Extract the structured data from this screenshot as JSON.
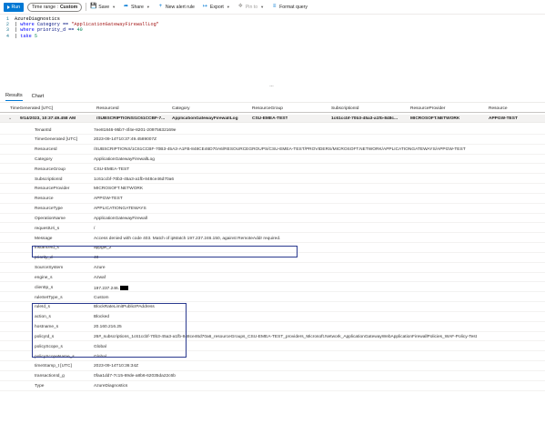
{
  "toolbar": {
    "run_label": "Run",
    "time_range_label": "Time range :",
    "time_range_value": "Custom",
    "save_label": "Save",
    "share_label": "Share",
    "new_alert_label": "New alert rule",
    "export_label": "Export",
    "pin_label": "Pin to",
    "format_label": "Format query"
  },
  "editor": {
    "lines": [
      {
        "num": "1",
        "parts": [
          {
            "t": "AzureDiagnostics",
            "c": "plain"
          }
        ]
      },
      {
        "num": "2",
        "parts": [
          {
            "t": "| ",
            "c": "plain"
          },
          {
            "t": "where",
            "c": "kw"
          },
          {
            "t": " Category == ",
            "c": "id"
          },
          {
            "t": "\"ApplicationGatewayFirewallLog\"",
            "c": "str"
          }
        ]
      },
      {
        "num": "3",
        "parts": [
          {
            "t": "| ",
            "c": "plain"
          },
          {
            "t": "where",
            "c": "kw"
          },
          {
            "t": " priority_d == ",
            "c": "id"
          },
          {
            "t": "40",
            "c": "num"
          }
        ]
      },
      {
        "num": "4",
        "parts": [
          {
            "t": "| ",
            "c": "plain"
          },
          {
            "t": "take",
            "c": "kw"
          },
          {
            "t": " ",
            "c": "plain"
          },
          {
            "t": "5",
            "c": "num"
          }
        ]
      }
    ]
  },
  "results_tabs": [
    "Results",
    "Chart"
  ],
  "grid": {
    "columns": [
      "TimeGenerated [UTC]",
      "ResourceId",
      "Category",
      "ResourceGroup",
      "SubscriptionId",
      "ResourceProvider",
      "Resource"
    ],
    "row": [
      "9/14/2023, 10:37:49.458 AM",
      "/SUBSCRIPTIONS/1C61CCBF-7...",
      "ApplicationGatewayFirewallLog",
      "CSU-EMEA-TEST",
      "1c61ccbf-70b3-45a3-a1fb-848c...",
      "MICROSOFT.NETWORK",
      "APPGW-TEST"
    ]
  },
  "details": [
    {
      "key": "TenantId",
      "value": "7ee81846-95b7-4f4e-8201-20975632169e"
    },
    {
      "key": "TimeGenerated [UTC]",
      "value": "2023-09-14T10:37:49.4589007Z"
    },
    {
      "key": "ResourceId",
      "value": "/SUBSCRIPTIONS/1C61CCBF-70B3-45A3-A1FB-848CE46D70A6/RESOURCEGROUPS/CSU-EMEA-TEST/PROVIDERS/MICROSOFT.NETWORK/APPLICATIONGATEWAYS/APPGW-TEST"
    },
    {
      "key": "Category",
      "value": "ApplicationGatewayFirewallLog"
    },
    {
      "key": "ResourceGroup",
      "value": "CSU-EMEA-TEST"
    },
    {
      "key": "SubscriptionId",
      "value": "1c61ccbf-70b3-45a3-a1fb-848ce46d70a6"
    },
    {
      "key": "ResourceProvider",
      "value": "MICROSOFT.NETWORK"
    },
    {
      "key": "Resource",
      "value": "APPGW-TEST"
    },
    {
      "key": "ResourceType",
      "value": "APPLICATIONGATEWAYS"
    },
    {
      "key": "OperationName",
      "value": "ApplicationGatewayFirewall"
    },
    {
      "key": "requestUri_s",
      "value": "/"
    },
    {
      "key": "Message",
      "value": "Access denied with code 403. Match of ipMatch 197.237.246.150, against RemoteAddr required."
    },
    {
      "key": "instanceId_s",
      "value": "appgw_2"
    },
    {
      "key": "priority_d",
      "value": "40"
    },
    {
      "key": "SourceSystem",
      "value": "Azure"
    },
    {
      "key": "engine_s",
      "value": "Azwaf"
    },
    {
      "key": "clientIp_s",
      "value": "197.237.246.",
      "redacted": true
    },
    {
      "key": "ruleSetType_s",
      "value": "Custom"
    },
    {
      "key": "ruleId_s",
      "value": "BlockRateLimitPublicIPAddress"
    },
    {
      "key": "action_s",
      "value": "Blocked"
    },
    {
      "key": "hostname_s",
      "value": "20.160.216.25"
    },
    {
      "key": "policyId_s",
      "value": "26#_subscriptions_1c61ccbf-70b3-45a3-a1fb-848ce46d70a6_resourceGroups_CSU-EMEA-TEST_providers_Microsoft.Network_ApplicationGatewayWebApplicationFirewallPolicies_WAF-Policy-Test"
    },
    {
      "key": "policyScope_s",
      "value": "Global"
    },
    {
      "key": "policyScopeName_s",
      "value": "Global"
    },
    {
      "key": "timeStamp_t [UTC]",
      "value": "2023-09-14T10:36:34Z"
    },
    {
      "key": "transactionId_g",
      "value": "0faa1dd7-7c15-69de-a8b6-62035da22c6b"
    },
    {
      "key": "Type",
      "value": "AzureDiagnostics"
    }
  ]
}
